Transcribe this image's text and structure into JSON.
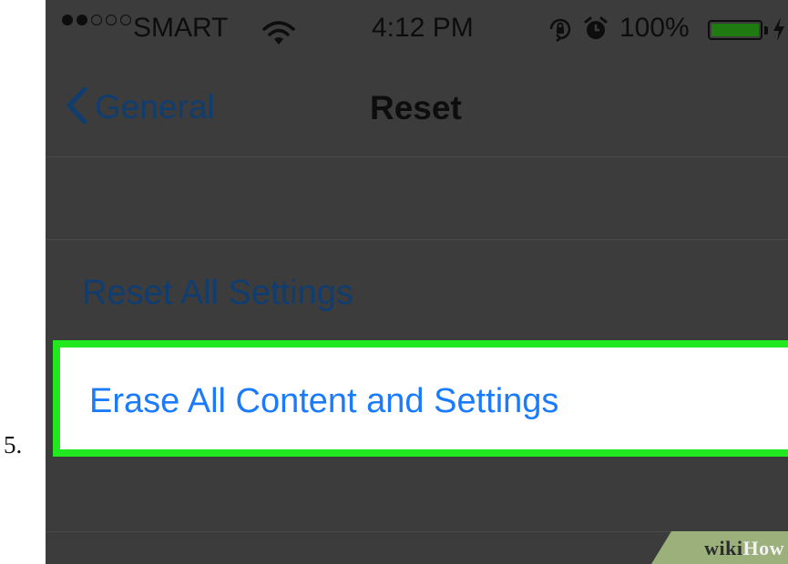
{
  "step": {
    "number": "5."
  },
  "status_bar": {
    "signal_bars_full": 2,
    "signal_bars_total": 5,
    "carrier": "SMART",
    "time": "4:12 PM",
    "battery_percent": "100%",
    "battery_level": 1.0,
    "battery_color": "#1f7a12",
    "icons": [
      "wifi-icon",
      "orientation-lock-icon",
      "alarm-icon",
      "battery-icon",
      "charging-bolt-icon"
    ]
  },
  "nav": {
    "back_label": "General",
    "title": "Reset",
    "back_icon": "chevron-left-icon"
  },
  "rows": {
    "reset_all": "Reset All Settings",
    "erase_all": "Erase All Content and Settings"
  },
  "highlight": {
    "color": "#22e81f"
  },
  "watermark": {
    "wiki": "wiki",
    "how": "How"
  }
}
